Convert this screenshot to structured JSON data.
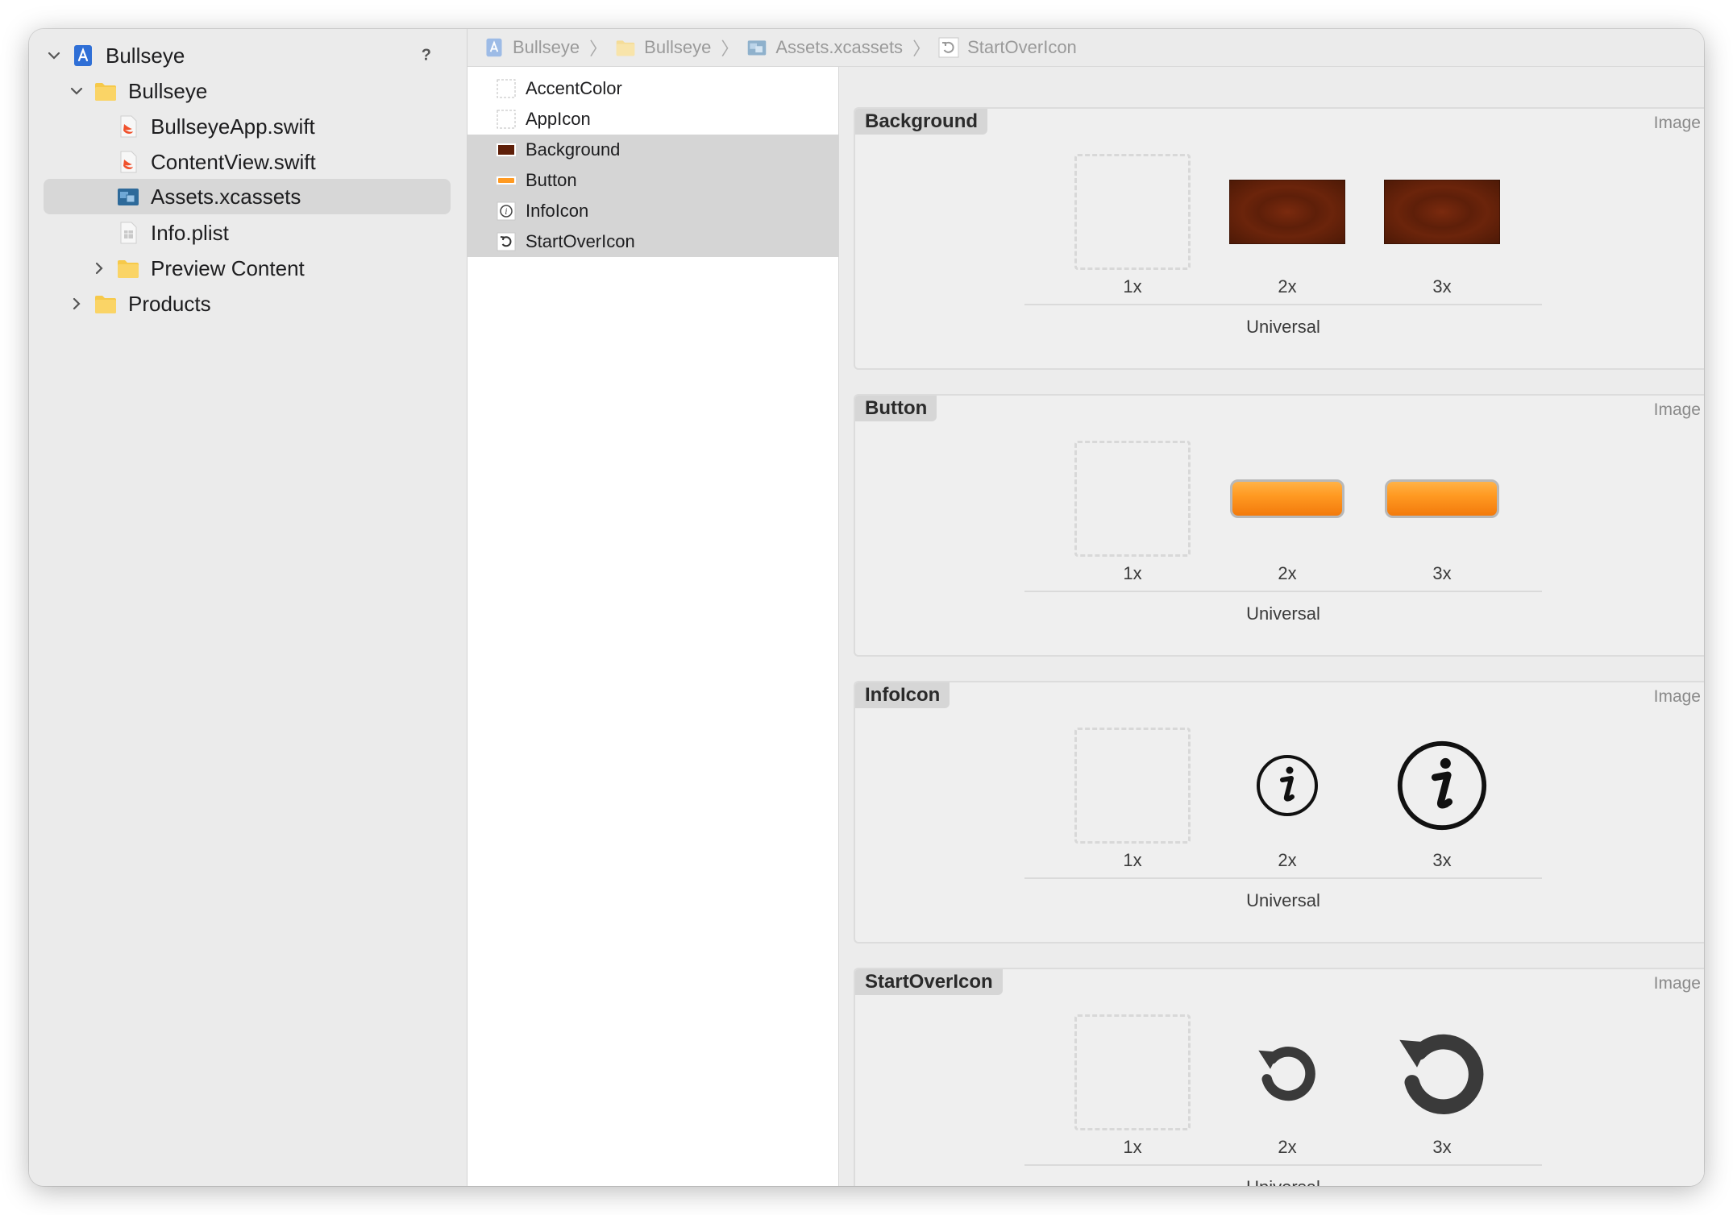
{
  "navigator": {
    "help_label": "?",
    "items": [
      {
        "label": "Bullseye",
        "icon": "project-icon",
        "expanded": true
      },
      {
        "label": "Bullseye",
        "icon": "folder-icon",
        "expanded": true
      },
      {
        "label": "BullseyeApp.swift",
        "icon": "swift-file-icon"
      },
      {
        "label": "ContentView.swift",
        "icon": "swift-file-icon"
      },
      {
        "label": "Assets.xcassets",
        "icon": "asset-catalog-icon",
        "selected": true
      },
      {
        "label": "Info.plist",
        "icon": "plist-file-icon"
      },
      {
        "label": "Preview Content",
        "icon": "folder-icon",
        "expanded": false
      },
      {
        "label": "Products",
        "icon": "folder-icon",
        "expanded": false
      }
    ]
  },
  "jumpbar": {
    "crumbs": [
      {
        "label": "Bullseye",
        "icon": "project-icon"
      },
      {
        "label": "Bullseye",
        "icon": "folder-icon"
      },
      {
        "label": "Assets.xcassets",
        "icon": "asset-catalog-icon"
      },
      {
        "label": "StartOverIcon",
        "icon": "start-over-icon"
      }
    ]
  },
  "asset_list": {
    "items": [
      {
        "label": "AccentColor",
        "selected": false
      },
      {
        "label": "AppIcon",
        "selected": false
      },
      {
        "label": "Background",
        "selected": true
      },
      {
        "label": "Button",
        "selected": true
      },
      {
        "label": "InfoIcon",
        "selected": true
      },
      {
        "label": "StartOverIcon",
        "selected": true
      }
    ]
  },
  "editor": {
    "sets": [
      {
        "title": "Background",
        "type": "Image",
        "slots": [
          "1x",
          "2x",
          "3x"
        ],
        "group": "Universal"
      },
      {
        "title": "Button",
        "type": "Image",
        "slots": [
          "1x",
          "2x",
          "3x"
        ],
        "group": "Universal"
      },
      {
        "title": "InfoIcon",
        "type": "Image",
        "slots": [
          "1x",
          "2x",
          "3x"
        ],
        "group": "Universal"
      },
      {
        "title": "StartOverIcon",
        "type": "Image",
        "slots": [
          "1x",
          "2x",
          "3x"
        ],
        "group": "Universal"
      }
    ]
  },
  "colors": {
    "accent_blue": "#2f6fd6",
    "folder_yellow": "#f6c94a",
    "swift_orange": "#f0512c",
    "background_brown": "#5e1f09",
    "button_orange": "#ff9a22"
  }
}
